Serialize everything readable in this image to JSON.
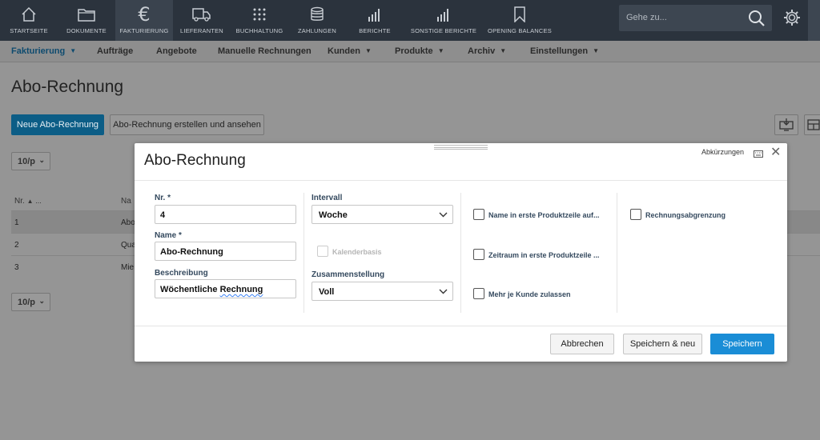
{
  "nav": {
    "items": [
      {
        "label": "STARTSEITE",
        "icon": "home-icon"
      },
      {
        "label": "DOKUMENTE",
        "icon": "folder-icon"
      },
      {
        "label": "FAKTURIERUNG",
        "icon": "euro-icon"
      },
      {
        "label": "LIEFERANTEN",
        "icon": "truck-icon"
      },
      {
        "label": "BUCHHALTUNG",
        "icon": "grid-dots-icon"
      },
      {
        "label": "ZAHLUNGEN",
        "icon": "coins-icon"
      },
      {
        "label": "BERICHTE",
        "icon": "bar-chart-icon"
      },
      {
        "label": "SONSTIGE BERICHTE",
        "icon": "bar-chart-icon"
      },
      {
        "label": "OPENING BALANCES",
        "icon": "bookmark-icon"
      }
    ],
    "search_placeholder": "Gehe zu..."
  },
  "subnav": {
    "items": [
      "Fakturierung",
      "Aufträge",
      "Angebote",
      "Manuelle Rechnungen",
      "Kunden",
      "Produkte",
      "Archiv",
      "Einstellungen"
    ]
  },
  "page": {
    "title": "Abo-Rechnung",
    "new_button": "Neue Abo-Rechnung",
    "create_view_button": "Abo-Rechnung erstellen und ansehen",
    "page_size": "10/p",
    "table": {
      "col_nr": "Nr.",
      "col_name": "Na",
      "rows": [
        {
          "nr": "1",
          "name": "Abo"
        },
        {
          "nr": "2",
          "name": "Qua"
        },
        {
          "nr": "3",
          "name": "Mie"
        }
      ]
    }
  },
  "modal": {
    "title": "Abo-Rechnung",
    "shortcuts": "Abkürzungen",
    "nr_label": "Nr. *",
    "nr_value": "4",
    "name_label": "Name *",
    "name_value": "Abo-Rechnung",
    "desc_label": "Beschreibung",
    "desc_value_1": "Wöchentliche",
    "desc_value_2": "Rechnung",
    "interval_label": "Intervall",
    "interval_value": "Woche",
    "calendar_basis": "Kalenderbasis",
    "composition_label": "Zusammenstellung",
    "composition_value": "Voll",
    "cb_name_first_line": "Name in erste Produktzeile auf...",
    "cb_period_first_line": "Zeitraum in erste Produktzeile ...",
    "cb_multiple_per_customer": "Mehr je Kunde zulassen",
    "cb_invoice_accrual": "Rechnungsabgrenzung",
    "cancel": "Abbrechen",
    "save_new": "Speichern & neu",
    "save": "Speichern"
  }
}
